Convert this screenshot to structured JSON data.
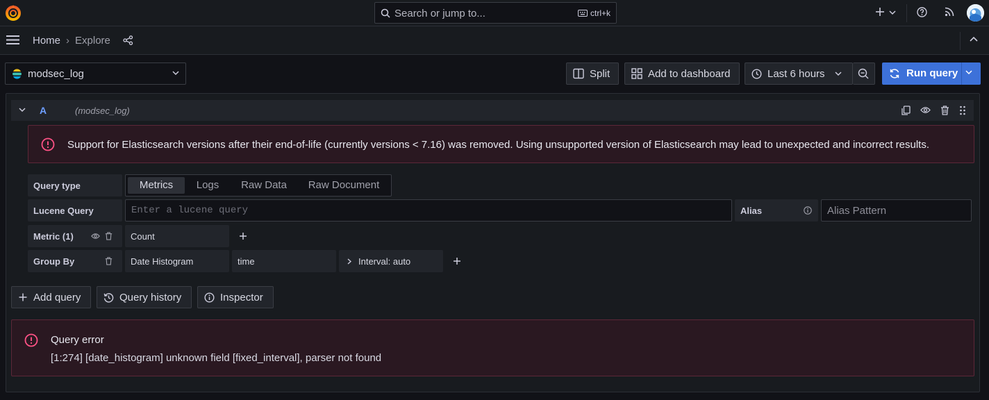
{
  "app": {
    "accent": "#3d71d9",
    "error_color": "#e0226e"
  },
  "topbar": {
    "search_placeholder": "Search or jump to...",
    "shortcut": "ctrl+k",
    "icons": [
      "grafana-logo-icon",
      "search-icon",
      "keyboard-icon",
      "plus-icon",
      "chevron-down-icon",
      "help-icon",
      "rss-icon",
      "user-avatar"
    ]
  },
  "breadcrumb": {
    "home": "Home",
    "separator": "›",
    "current": "Explore"
  },
  "toolbar": {
    "datasource": "modsec_log",
    "split": "Split",
    "add_to_dashboard": "Add to dashboard",
    "time_range": "Last 6 hours",
    "run_query": "Run query"
  },
  "query": {
    "ref_id": "A",
    "datasource_label": "(modsec_log)",
    "warning": "Support for Elasticsearch versions after their end-of-life (currently versions < 7.16) was removed. Using unsupported version of Elasticsearch may lead to unexpected and incorrect results.",
    "query_type_label": "Query type",
    "query_types": [
      "Metrics",
      "Logs",
      "Raw Data",
      "Raw Document"
    ],
    "query_type_selected": "Metrics",
    "lucene_label": "Lucene Query",
    "lucene_placeholder": "Enter a lucene query",
    "alias_label": "Alias",
    "alias_placeholder": "Alias Pattern",
    "metric_label": "Metric (1)",
    "metric_value": "Count",
    "group_by_label": "Group By",
    "group_by_type": "Date Histogram",
    "group_by_field": "time",
    "interval": "Interval: auto"
  },
  "actions": {
    "add_query": "Add query",
    "query_history": "Query history",
    "inspector": "Inspector"
  },
  "error": {
    "title": "Query error",
    "message": "[1:274] [date_histogram] unknown field [fixed_interval], parser not found"
  }
}
